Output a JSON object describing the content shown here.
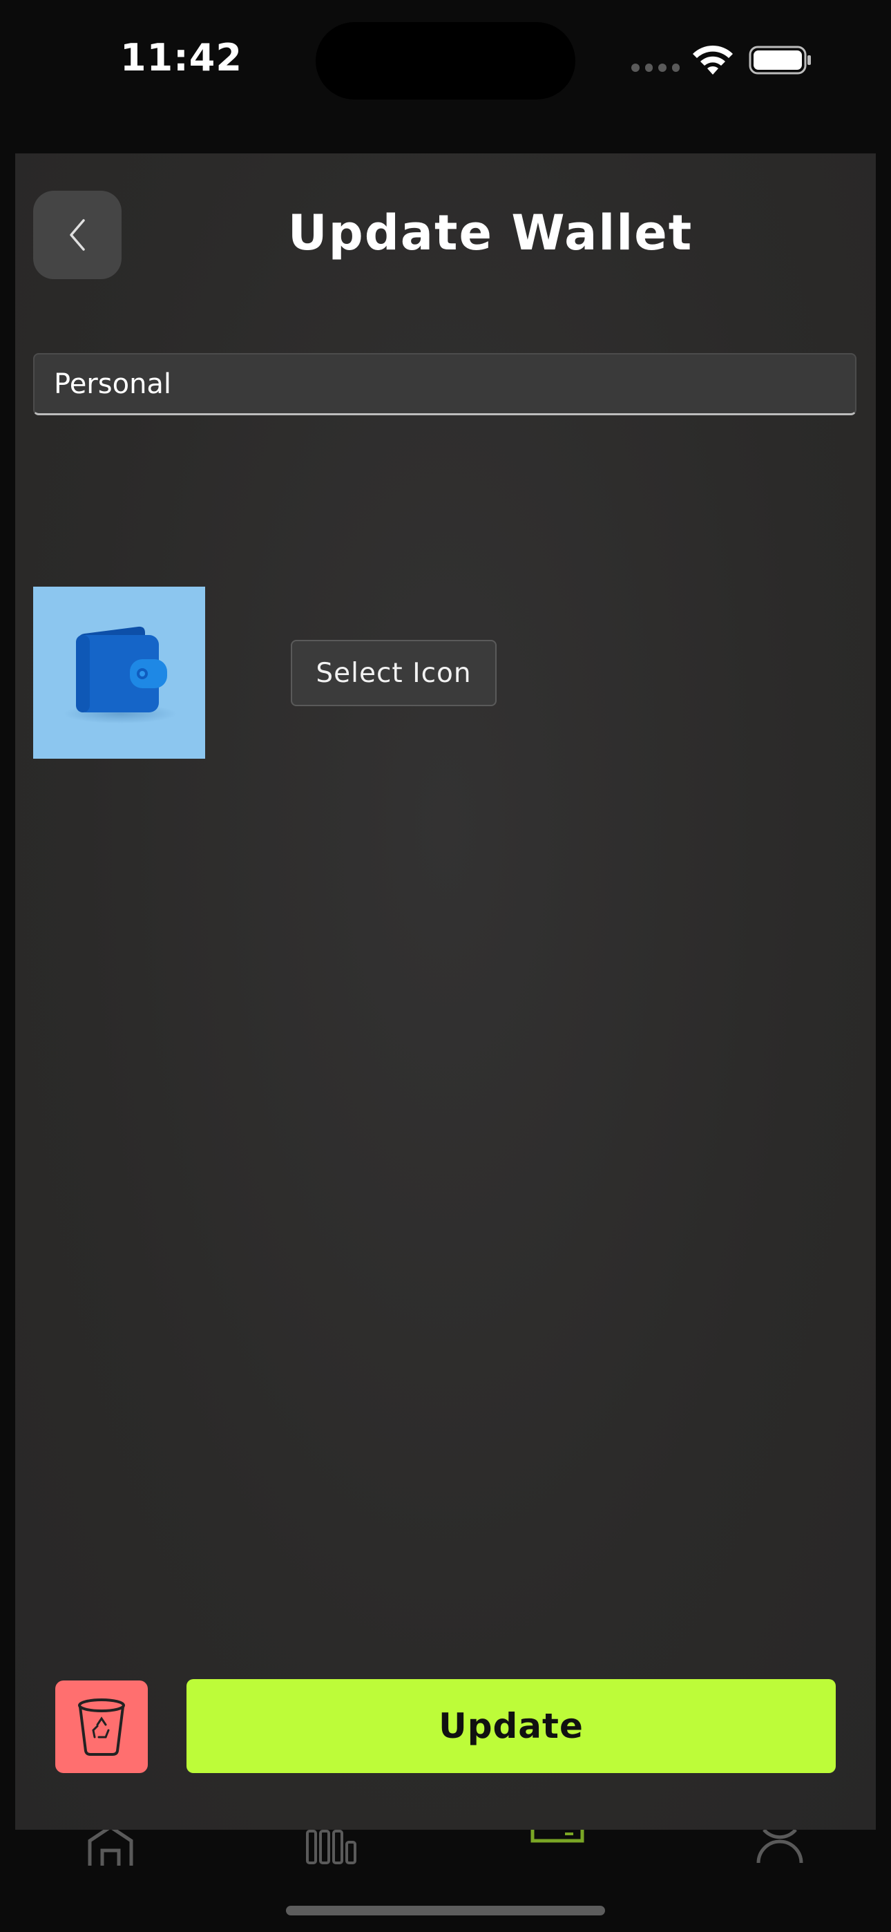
{
  "status_bar": {
    "time": "11:42",
    "icons": [
      "signal-dots",
      "wifi-icon",
      "battery-icon"
    ]
  },
  "header": {
    "title": "Update Wallet",
    "back_icon": "chevron-left-icon"
  },
  "form": {
    "wallet_name_value": "Personal",
    "wallet_icon": "wallet-icon",
    "select_icon_label": "Select Icon"
  },
  "actions": {
    "delete_icon": "trash-icon",
    "update_label": "Update"
  },
  "tab_bar": {
    "items": [
      {
        "icon": "home-icon"
      },
      {
        "icon": "stats-icon"
      },
      {
        "icon": "wallet-icon",
        "active": true
      },
      {
        "icon": "profile-icon"
      }
    ]
  },
  "colors": {
    "accent": "#bdfc39",
    "danger": "#ff6f6f",
    "sheet_bg": "#2e2d2c",
    "screen_bg": "#0b0b0b",
    "wallet_thumb_bg": "#8cc6ef",
    "wallet_blue": "#1565c8"
  }
}
